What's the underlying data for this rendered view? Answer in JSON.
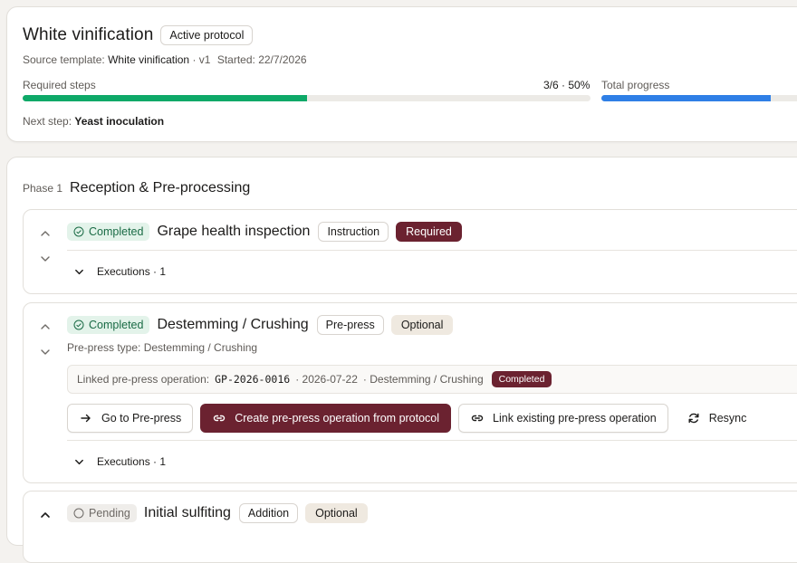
{
  "header": {
    "title": "White vinification",
    "status_badge": "Active protocol",
    "source_template_label": "Source template:",
    "source_template_value": "White vinification",
    "version": "· v1",
    "started_label": "Started:",
    "started_value": "22/7/2026",
    "required_steps_label": "Required steps",
    "required_steps_value": "3/6 · 50%",
    "required_progress_fraction": 0.5,
    "total_progress_label": "Total progress",
    "total_progress_fraction": 0.78,
    "next_step_label": "Next step:",
    "next_step_value": "Yeast inoculation"
  },
  "phase": {
    "number": "Phase 1",
    "title": "Reception & Pre-processing",
    "steps": [
      {
        "status": "Completed",
        "title": "Grape health inspection",
        "type_tag": "Instruction",
        "requirement": "Required",
        "executions": "Executions · 1"
      },
      {
        "status": "Completed",
        "title": "Destemming / Crushing",
        "type_tag": "Pre-press",
        "requirement": "Optional",
        "subtype": "Pre-press type: Destemming / Crushing",
        "linked": {
          "label": "Linked pre-press operation:",
          "code": "GP-2026-0016",
          "date": "· 2026-07-22",
          "operation": "· Destemming / Crushing",
          "status": "Completed"
        },
        "buttons": {
          "go_to": "Go to Pre-press",
          "create": "Create pre-press operation from protocol",
          "link_existing": "Link existing pre-press operation",
          "resync": "Resync"
        },
        "executions": "Executions · 1"
      },
      {
        "status": "Pending",
        "title": "Initial sulfiting",
        "type_tag": "Addition",
        "requirement": "Optional"
      }
    ]
  },
  "icons": {
    "arrow_up": "chevron-up-icon",
    "arrow_down": "chevron-down-icon",
    "check_circle": "check-circle-icon",
    "pending_circle": "circle-icon",
    "arrow_right": "arrow-right-icon",
    "link": "link-icon",
    "refresh": "refresh-icon"
  },
  "colors": {
    "brand": "#6b2230",
    "required_progress": "#0ea968",
    "total_progress": "#2f7fe6",
    "completed_bg": "#e3f3ea",
    "completed_fg": "#1a6b45"
  }
}
